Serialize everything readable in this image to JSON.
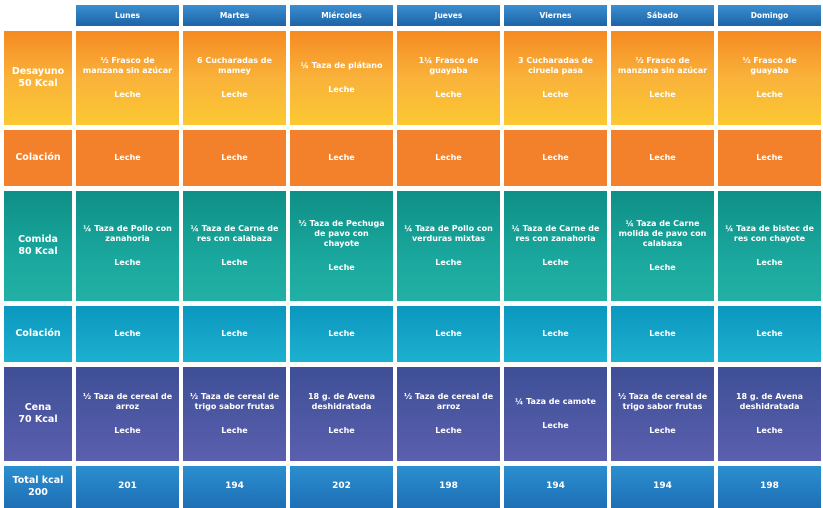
{
  "days": [
    "Lunes",
    "Martes",
    "Miércoles",
    "Jueves",
    "Viernes",
    "Sábado",
    "Domingo"
  ],
  "rows": [
    {
      "label1": "Desayuno",
      "label2": "50 Kcal",
      "class": "desayuno",
      "cells": [
        {
          "food": "½ Frasco de manzana sin azúcar",
          "drink": "Leche"
        },
        {
          "food": "6 Cucharadas de mamey",
          "drink": "Leche"
        },
        {
          "food": "¼ Taza de plátano",
          "drink": "Leche"
        },
        {
          "food": "1¼ Frasco de guayaba",
          "drink": "Leche"
        },
        {
          "food": "3 Cucharadas de ciruela pasa",
          "drink": "Leche"
        },
        {
          "food": "½ Frasco de manzana sin azúcar",
          "drink": "Leche"
        },
        {
          "food": "½ Frasco de guayaba",
          "drink": "Leche"
        }
      ]
    },
    {
      "label1": "Colación",
      "label2": "",
      "class": "colacion1",
      "cells": [
        {
          "food": "",
          "drink": "Leche"
        },
        {
          "food": "",
          "drink": "Leche"
        },
        {
          "food": "",
          "drink": "Leche"
        },
        {
          "food": "",
          "drink": "Leche"
        },
        {
          "food": "",
          "drink": "Leche"
        },
        {
          "food": "",
          "drink": "Leche"
        },
        {
          "food": "",
          "drink": "Leche"
        }
      ]
    },
    {
      "label1": "Comida",
      "label2": "80 Kcal",
      "class": "comida",
      "cells": [
        {
          "food": "¼ Taza de Pollo con zanahoria",
          "drink": "Leche"
        },
        {
          "food": "¼ Taza de Carne de res con calabaza",
          "drink": "Leche"
        },
        {
          "food": "½ Taza de Pechuga de pavo con chayote",
          "drink": "Leche"
        },
        {
          "food": "¼ Taza de Pollo con verduras mixtas",
          "drink": "Leche"
        },
        {
          "food": "¼ Taza de Carne de res con zanahoria",
          "drink": "Leche"
        },
        {
          "food": "¼ Taza de Carne molida de pavo con calabaza",
          "drink": "Leche"
        },
        {
          "food": "¼ Taza de bistec de res con chayote",
          "drink": "Leche"
        }
      ]
    },
    {
      "label1": "Colación",
      "label2": "",
      "class": "colacion2",
      "cells": [
        {
          "food": "",
          "drink": "Leche"
        },
        {
          "food": "",
          "drink": "Leche"
        },
        {
          "food": "",
          "drink": "Leche"
        },
        {
          "food": "",
          "drink": "Leche"
        },
        {
          "food": "",
          "drink": "Leche"
        },
        {
          "food": "",
          "drink": "Leche"
        },
        {
          "food": "",
          "drink": "Leche"
        }
      ]
    },
    {
      "label1": "Cena",
      "label2": "70 Kcal",
      "class": "cena",
      "cells": [
        {
          "food": "½ Taza de cereal de arroz",
          "drink": "Leche"
        },
        {
          "food": "½ Taza de cereal de trigo sabor frutas",
          "drink": "Leche"
        },
        {
          "food": "18 g. de Avena deshidratada",
          "drink": "Leche"
        },
        {
          "food": "½ Taza de cereal de arroz",
          "drink": "Leche"
        },
        {
          "food": "¼ Taza de camote",
          "drink": "Leche"
        },
        {
          "food": "½ Taza de cereal de trigo sabor frutas",
          "drink": "Leche"
        },
        {
          "food": "18 g. de Avena deshidratada",
          "drink": "Leche"
        }
      ]
    }
  ],
  "total": {
    "label1": "Total kcal",
    "label2": "200",
    "values": [
      "201",
      "194",
      "202",
      "198",
      "194",
      "194",
      "198"
    ]
  },
  "colors": {
    "header": "#2a7cc2",
    "desayuno": "#f9a52e",
    "colacion1": "#f3802a",
    "comida": "#169c92",
    "colacion2": "#12a4c8",
    "cena": "#4b57a2",
    "total": "#2a84c6"
  }
}
